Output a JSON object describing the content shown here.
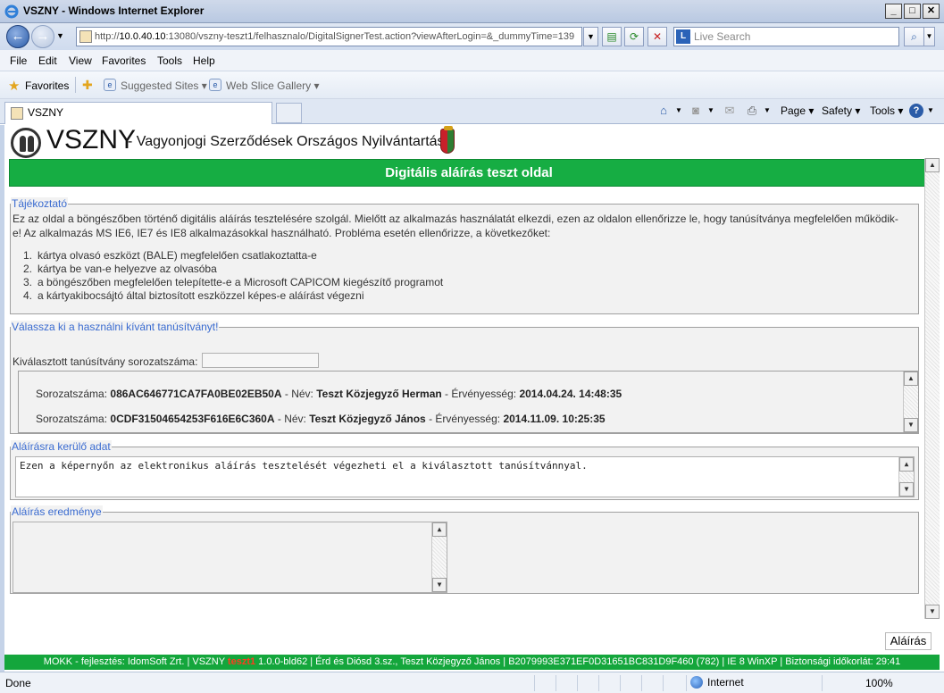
{
  "window": {
    "title": "VSZNY - Windows Internet Explorer"
  },
  "address": {
    "url_prefix": "http://",
    "url_host": "10.0.40.10",
    "url_rest": ":13080/vszny-teszt1/felhasznalo/DigitalSignerTest.action?viewAfterLogin=&_dummyTime=139",
    "search_placeholder": "Live Search"
  },
  "menu": [
    "File",
    "Edit",
    "View",
    "Favorites",
    "Tools",
    "Help"
  ],
  "favorites": {
    "label": "Favorites",
    "links": [
      "Suggested Sites ▾",
      "Web Slice Gallery ▾"
    ]
  },
  "tab": {
    "title": "VSZNY"
  },
  "commands": {
    "page": "Page ▾",
    "safety": "Safety ▾",
    "tools": "Tools ▾"
  },
  "header": {
    "brand": "VSZNY",
    "tagline": "- Vagyonjogi Szerződések Országos Nyilvántartása"
  },
  "page_title": "Digitális aláírás teszt oldal",
  "info": {
    "legend": "Tájékoztató",
    "paragraph_line1": "Ez az oldal a böngészőben történő digitális aláírás tesztelésére szolgál. Mielőtt az alkalmazás használatát elkezdi, ezen az oldalon ellenőrizze le, hogy tanúsítványa megfelelően működik-",
    "paragraph_line2": "e! Az alkalmazás MS IE6, IE7 és IE8 alkalmazásokkal használható. Probléma esetén ellenőrizze, a következőket:",
    "items": [
      {
        "num": "1.",
        "text": "kártya olvasó eszközt (BALE) megfelelően csatlakoztatta-e"
      },
      {
        "num": "2.",
        "text": "kártya be van-e helyezve az olvasóba"
      },
      {
        "num": "3.",
        "text": "a böngészőben megfelelően telepítette-e a Microsoft CAPICOM kiegészítő programot"
      },
      {
        "num": "4.",
        "text": "a kártyakibocsájtó által biztosított eszközzel képes-e aláírást végezni"
      }
    ]
  },
  "cert": {
    "legend": "Válassza ki a használni kívánt tanúsítványt!",
    "serial_label": "Kiválasztott tanúsítvány sorozatszáma:",
    "serial_value": "",
    "rows": [
      {
        "serial_label": "Sorozatszáma:",
        "serial": "086AC646771CA7FA0BE02EB50A",
        "name_label": "- Név:",
        "name": "Teszt Közjegyző Herman",
        "valid_label": "- Érvényesség:",
        "valid": "2014.04.24. 14:48:35"
      },
      {
        "serial_label": "Sorozatszáma:",
        "serial": "0CDF31504654253F616E6C360A",
        "name_label": "- Név:",
        "name": "Teszt Közjegyző János",
        "valid_label": "- Érvényesség:",
        "valid": "2014.11.09. 10:25:35"
      }
    ]
  },
  "data_section": {
    "legend": "Aláírásra kerülő adat",
    "text": "Ezen a képernyőn az elektronikus aláírás tesztelését végezheti el a kiválasztott tanúsítvánnyal."
  },
  "result_section": {
    "legend": "Aláírás eredménye",
    "text": ""
  },
  "sign_button": "Aláírás",
  "footer": {
    "part1": "MOKK - fejlesztés: IdomSoft Zrt.  |  VSZNY ",
    "env": "teszt1",
    "part2": " 1.0.0-bld62  |  Érd és Diósd 3.sz., Teszt Közjegyző János  |  B2079993E371EF0D31651BC831D9F460 (782)  |  IE 8 WinXP  |  Biztonsági időkorlát:  29:41"
  },
  "status": {
    "text": "Done",
    "zone": "Internet",
    "zoom": "100%"
  },
  "colors": {
    "accent_green": "#16ad43",
    "legend_blue": "#3a6bd0",
    "env_red": "#ff3b1f"
  }
}
